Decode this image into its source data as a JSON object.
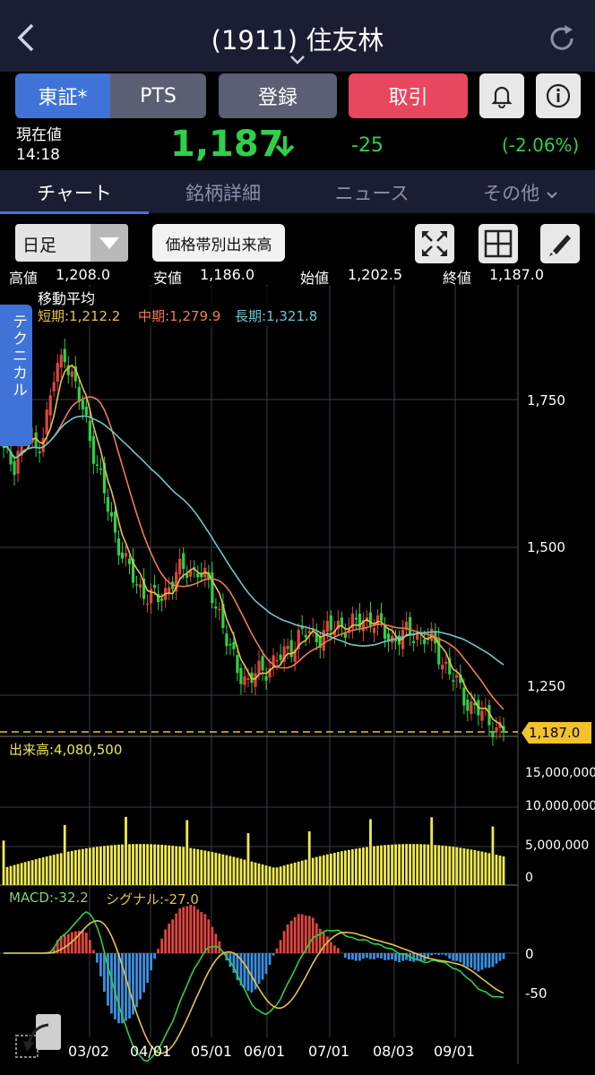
{
  "header": {
    "title": "(1911) 住友林"
  },
  "buttons": {
    "tosho": "東証*",
    "pts": "PTS",
    "register": "登録",
    "trade": "取引"
  },
  "price": {
    "label": "現在値",
    "time": "14:18",
    "value": "1,187",
    "change": "-25",
    "change_pct": "(-2.06%)"
  },
  "tabs": [
    "チャート",
    "銘柄詳細",
    "ニュース",
    "その他"
  ],
  "toolbar": {
    "period": "日足",
    "volume_by_price": "価格帯別出来高"
  },
  "ohlc": {
    "high_label": "高値",
    "high": "1,208.0",
    "low_label": "安値",
    "low": "1,186.0",
    "open_label": "始値",
    "open": "1,202.5",
    "close_label": "終値",
    "close": "1,187.0"
  },
  "technical_tab": "テクニカル",
  "moving_avg": {
    "title": "移動平均",
    "short": "短期:1,212.2",
    "mid": "中期:1,279.9",
    "long": "長期:1,321.8"
  },
  "volume_label": "出来高:4,080,500",
  "macd": {
    "macd": "MACD:-32.2",
    "signal": "シグナル:-27.0"
  },
  "current_tag": "1,187.0",
  "colors": {
    "up": "#e0463f",
    "down": "#2ecf45",
    "short_ma": "#e3c34a",
    "mid_ma": "#f07a55",
    "long_ma": "#6fc6cc",
    "volume": "#eeea4e"
  },
  "chart_data": {
    "type": "candlestick",
    "price_axis": {
      "ticks": [
        "1,750",
        "1,500",
        "1,250"
      ],
      "range": [
        1175,
        1900
      ]
    },
    "volume_axis": {
      "ticks": [
        "15,000,000",
        "10,000,000",
        "5,000,000",
        "0"
      ],
      "range": [
        0,
        17000000
      ]
    },
    "macd_axis": {
      "ticks": [
        "0",
        "-50"
      ],
      "range": [
        -85,
        75
      ]
    },
    "x_ticks": [
      "03/02",
      "04/01",
      "05/01",
      "06/01",
      "07/01",
      "08/03",
      "09/01"
    ],
    "close_path": [
      1660,
      1640,
      1700,
      1660,
      1700,
      1790,
      1830,
      1770,
      1720,
      1650,
      1580,
      1520,
      1470,
      1440,
      1420,
      1410,
      1430,
      1455,
      1465,
      1460,
      1440,
      1400,
      1330,
      1295,
      1270,
      1290,
      1300,
      1310,
      1330,
      1350,
      1355,
      1350,
      1360,
      1370,
      1365,
      1375,
      1380,
      1360,
      1345,
      1350,
      1355,
      1350,
      1340,
      1310,
      1280,
      1250,
      1230,
      1215,
      1200,
      1187
    ]
  }
}
